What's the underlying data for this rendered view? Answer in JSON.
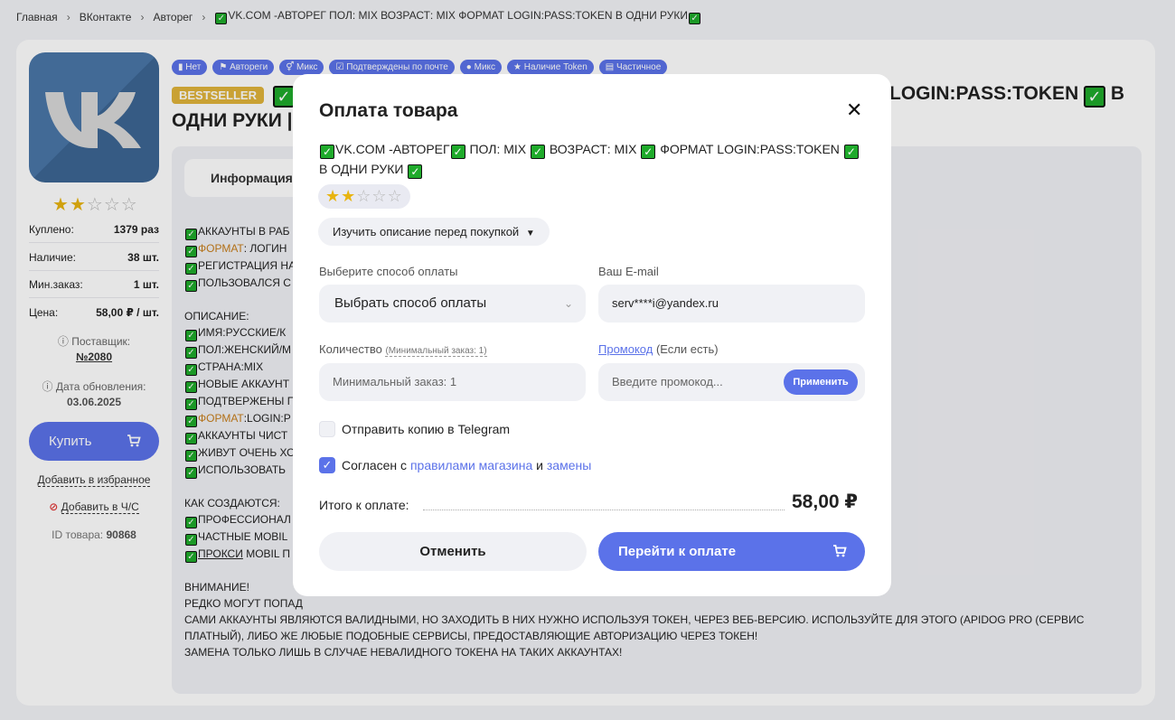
{
  "breadcrumb": {
    "home": "Главная",
    "vk": "ВКонтакте",
    "autoreg": "Авторег",
    "current": "VK.COM -АВТОРЕГ ПОЛ: MIX ВОЗРАСТ: MIX ФОРМАТ LOGIN:PASS:TOKEN В ОДНИ РУКИ"
  },
  "product": {
    "rating": 2,
    "rating_max": 5,
    "stats": [
      {
        "label": "Куплено:",
        "value": "1379 раз"
      },
      {
        "label": "Наличие:",
        "value": "38 шт."
      },
      {
        "label": "Мин.заказ:",
        "value": "1 шт."
      },
      {
        "label": "Цена:",
        "value": "58,00 ₽ / шт."
      }
    ],
    "supplier_label": "Поставщик:",
    "supplier": "№2080",
    "updated_label": "Дата обновления:",
    "updated": "03.06.2025",
    "buy_label": "Купить",
    "favorite_label": "Добавить в избранное",
    "blacklist_label": "Добавить в Ч/С",
    "id_label": "ID товара:",
    "id": "90868",
    "badges": [
      "Нет",
      "Автореги",
      "Микс",
      "Подтверждены по почте",
      "Микс",
      "Наличие Token",
      "Частичное"
    ],
    "bestseller": "BESTSELLER",
    "title_line1_right": "LOGIN:PASS:TOKEN",
    "title_line1_tail": "В",
    "title_line2": "ОДНИ РУКИ",
    "tab_info": "Информация",
    "desc": {
      "l1": "АККАУНТЫ В РАБ",
      "l2a": "ФОРМАТ",
      "l2b": ": ЛОГИН",
      "l3": "РЕГИСТРАЦИЯ НА",
      "l4": "ПОЛЬЗОВАЛСЯ С",
      "opis": "ОПИСАНИЕ:",
      "o1": "ИМЯ:РУССКИЕ/К",
      "o2": "ПОЛ:ЖЕНСКИЙ/М",
      "o3": "СТРАНА:MIX",
      "o4": "НОВЫЕ АККАУНТ",
      "o5": "ПОДТВЕРЖЕНЫ П",
      "o6a": "ФОРМАТ",
      "o6b": ":LOGIN:P",
      "o7": "АККАУНТЫ ЧИСТ",
      "o8": "ЖИВУТ ОЧЕНЬ ХО",
      "o9": "ИСПОЛЬЗОВАТЬ",
      "kak": "КАК СОЗДАЮТСЯ:",
      "k1": "ПРОФЕССИОНАЛ",
      "k2": "ЧАСТНЫЕ MOBIL",
      "k3a": "ПРОКСИ",
      "k3b": " MOBIL П",
      "vn": "ВНИМАНИЕ!",
      "v1": "РЕДКО МОГУТ ПОПАД",
      "v2": "САМИ АККАУНТЫ ЯВЛЯЮТСЯ ВАЛИДНЫМИ, НО ЗАХОДИТЬ В НИХ НУЖНО ИСПОЛЬЗУЯ ТОКЕН, ЧЕРЕЗ ВЕБ-ВЕРСИЮ. ИСПОЛЬЗУЙТЕ ДЛЯ ЭТОГО (APIDOG PRO (СЕРВИС ПЛАТНЫЙ), ЛИБО ЖЕ ЛЮБЫЕ ПОДОБНЫЕ СЕРВИСЫ, ПРЕДОСТАВЛЯЮЩИЕ АВТОРИЗАЦИЮ ЧЕРЕЗ ТОКЕН!",
      "v3": "ЗАМЕНА ТОЛЬКО ЛИШЬ В СЛУЧАЕ НЕВАЛИДНОГО ТОКЕНА НА ТАКИХ АККАУНТАХ!"
    }
  },
  "modal": {
    "title": "Оплата товара",
    "product_p1": "VK.COM -АВТОРЕГ",
    "product_p2": " ПОЛ: MIX ",
    "product_p3": " ВОЗРАСТ: MIX ",
    "product_p4": " ФОРМАТ LOGIN:PASS:TOKEN ",
    "product_p5": " В ОДНИ РУКИ ",
    "study_label": "Изучить описание перед покупкой",
    "pay_method_label": "Выберите способ оплаты",
    "pay_method_value": "Выбрать способ оплаты",
    "email_label": "Ваш E-mail",
    "email_value": "serv****i@yandex.ru",
    "qty_label": "Количество",
    "qty_hint": "(Минимальный заказ: 1)",
    "qty_placeholder": "Минимальный заказ: 1",
    "promo_link": "Промокод",
    "promo_hint": " (Если есть)",
    "promo_placeholder": "Введите промокод...",
    "apply_label": "Применить",
    "telegram_label": "Отправить копию в Telegram",
    "agree_prefix": "Согласен с ",
    "agree_rules": "правилами магазина",
    "agree_and": " и ",
    "agree_replace": "замены",
    "total_label": "Итого к оплате:",
    "total_value": "58,00 ₽",
    "cancel_label": "Отменить",
    "pay_label": "Перейти к оплате"
  },
  "colors": {
    "accent": "#5b72e9",
    "check": "#1faa2b",
    "star": "#e8b410"
  }
}
